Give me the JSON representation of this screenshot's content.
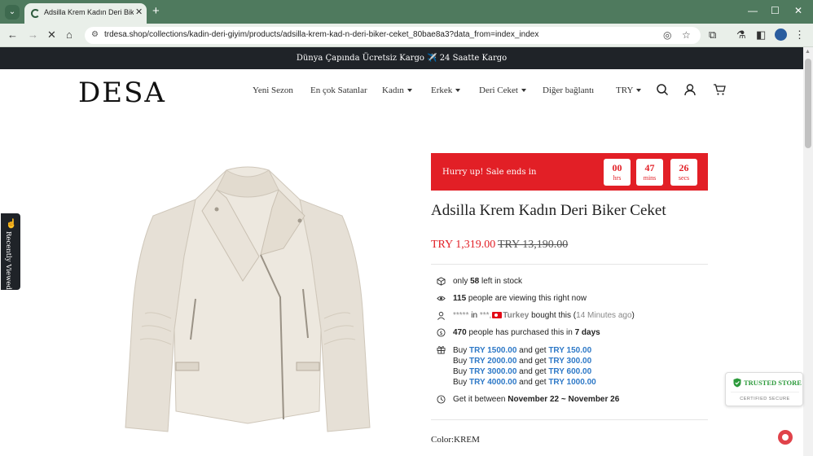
{
  "browser": {
    "tab_title": "Adsilla Krem Kadın Deri Biker C",
    "url": "trdesa.shop/collections/kadin-deri-giyim/products/adsilla-krem-kad-n-deri-biker-ceket_80bae8a3?data_from=index_index"
  },
  "announcement": "Dünya Çapında Ücretsiz Kargo ✈️ 24 Saatte Kargo",
  "header": {
    "logo": "DESA",
    "nav": [
      "Yeni Sezon",
      "En çok Satanlar",
      "Kadın",
      "Erkek",
      "Deri Ceket",
      "Diğer bağlantı"
    ],
    "currency": "TRY"
  },
  "recently_viewed": "Recently Viewed",
  "countdown": {
    "label": "Hurry up!  Sale ends in",
    "hours": "00",
    "hours_label": "hrs",
    "mins": "47",
    "mins_label": "mins",
    "secs": "26",
    "secs_label": "secs"
  },
  "product": {
    "title": "Adsilla Krem Kadın Deri Biker Ceket",
    "price": "TRY 1,319.00",
    "old_price": "TRY 13,190.00",
    "color_label": "Color:",
    "color_value": "KREM"
  },
  "info": {
    "stock_pre": "only ",
    "stock_count": "58",
    "stock_post": " left in stock",
    "viewing_count": "115",
    "viewing_post": " people are viewing this right now",
    "buyer_mask": "*****",
    "buyer_in": " in ",
    "buyer_city": "***,",
    "buyer_country": "Turkey",
    "buyer_post": " bought this (",
    "buyer_time": "14 Minutes ago",
    "buyer_close": ")",
    "purchased_count": "470",
    "purchased_mid": " people has purchased this in ",
    "purchased_days": "7 days",
    "delivery_pre": "Get it between ",
    "delivery_range": "November 22 ~ November 26"
  },
  "tiers": [
    {
      "buy": "TRY 1500.00",
      "get": "TRY 150.00"
    },
    {
      "buy": "TRY 2000.00",
      "get": "TRY 300.00"
    },
    {
      "buy": "TRY 3000.00",
      "get": "TRY 600.00"
    },
    {
      "buy": "TRY 4000.00",
      "get": "TRY 1000.00"
    }
  ],
  "tier_words": {
    "buy": "Buy ",
    "get": " and get "
  },
  "trusted": {
    "title": "TRUSTED STORE",
    "sub": "CERTIFIED SECURE"
  }
}
